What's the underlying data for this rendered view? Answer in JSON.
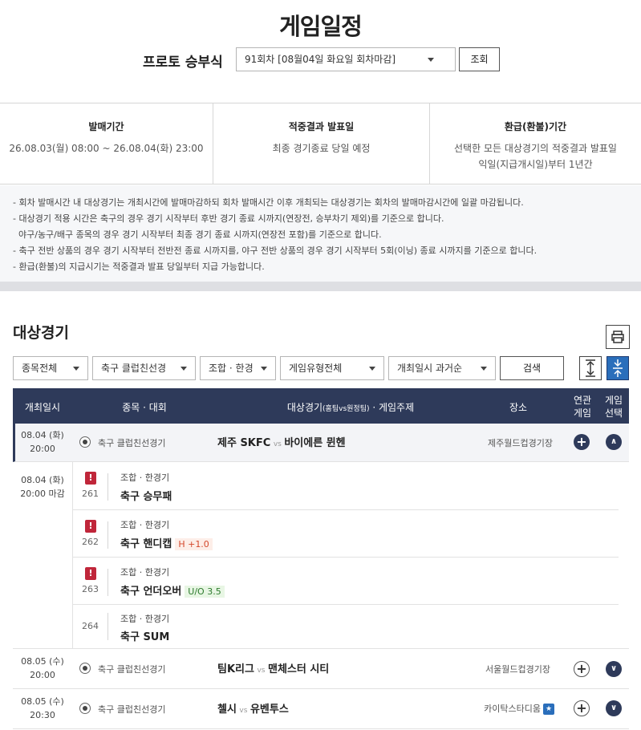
{
  "header": {
    "title": "게임일정",
    "proto_label": "프로토 승부식",
    "round_select": "91회차 [08월04일 화요일 회차마감]",
    "lookup_label": "조회"
  },
  "info": [
    {
      "heading": "발매기간",
      "value1": "26.08.03(월) 08:00 ~ 26.08.04(화) 23:00",
      "value2": ""
    },
    {
      "heading": "적중결과 발표일",
      "value1": "최종 경기종료 당일 예정",
      "value2": ""
    },
    {
      "heading": "환급(환불)기간",
      "value1": "선택한 모든 대상경기의 적중결과 발표일",
      "value2": "익일(지급개시일)부터 1년간"
    }
  ],
  "notes": [
    "- 회차 발매시간 내 대상경기는 개최시간에 발매마감하되 회차 발매시간 이후 개최되는 대상경기는 회차의 발매마감시간에 일괄 마감됩니다.",
    "- 대상경기 적용 시간은 축구의 경우 경기 시작부터 후반 경기 종료 시까지(연장전, 승부차기 제외)를 기준으로 합니다.",
    "  야구/농구/배구 종목의 경우 경기 시작부터 최종 경기 종료 시까지(연장전 포함)를 기준으로 합니다.",
    "- 축구 전반 상품의 경우 경기 시작부터 전반전 종료 시까지를, 야구 전반 상품의 경우 경기 시작부터 5회(이닝) 종료 시까지를 기준으로 합니다.",
    "- 환급(환불)의 지급시기는 적중결과 발표 당일부터 지급 가능합니다."
  ],
  "section_title": "대상경기",
  "filters": {
    "sport": "종목전체",
    "league": "축구 클럽친선경",
    "combo": "조합 · 한경",
    "game_type": "게임유형전체",
    "sort": "개최일시 과거순",
    "search_label": "검색"
  },
  "table_header": {
    "date": "개최일시",
    "league": "종목 · 대회",
    "match": "대상경기",
    "match_small": "(홈팀vs원정팀)",
    "theme": " · 게임주제",
    "venue": "장소",
    "related1": "연관",
    "related2": "게임",
    "select1": "게임",
    "select2": "선택"
  },
  "matches": [
    {
      "date": "08.04 (화)",
      "time": "20:00",
      "league": "축구 클럽친선경기",
      "home": "제주 SKFC",
      "vs": "vs",
      "away": "바이에른 뮌헨",
      "venue": "제주월드컵경기장",
      "related": "+",
      "toggle": "∧"
    },
    {
      "date": "08.05 (수)",
      "time": "20:00",
      "league": "축구 클럽친선경기",
      "home": "팀K리그",
      "vs": "vs",
      "away": "맨체스터 시티",
      "venue": "서울월드컵경기장",
      "related": "+",
      "toggle": "∨"
    },
    {
      "date": "08.05 (수)",
      "time": "20:30",
      "league": "축구 클럽친선경기",
      "home": "첼시",
      "vs": "vs",
      "away": "유벤투스",
      "venue": "카이탁스타디움",
      "venue_badge": "★",
      "related": "+",
      "toggle": "∨"
    }
  ],
  "sub_games": {
    "date": "08.04 (화)",
    "time": "20:00 마감",
    "items": [
      {
        "warn": "!",
        "num": "261",
        "kind": "조합 · 한경기",
        "sport": "축구 승무패",
        "tag": ""
      },
      {
        "warn": "!",
        "num": "262",
        "kind": "조합 · 한경기",
        "sport": "축구 핸디캡",
        "tag": "H +1.0"
      },
      {
        "warn": "!",
        "num": "263",
        "kind": "조합 · 한경기",
        "sport": "축구 언더오버",
        "tag": "U/O 3.5"
      },
      {
        "warn": "",
        "num": "264",
        "kind": "조합 · 한경기",
        "sport": "축구 SUM",
        "tag": ""
      }
    ]
  }
}
